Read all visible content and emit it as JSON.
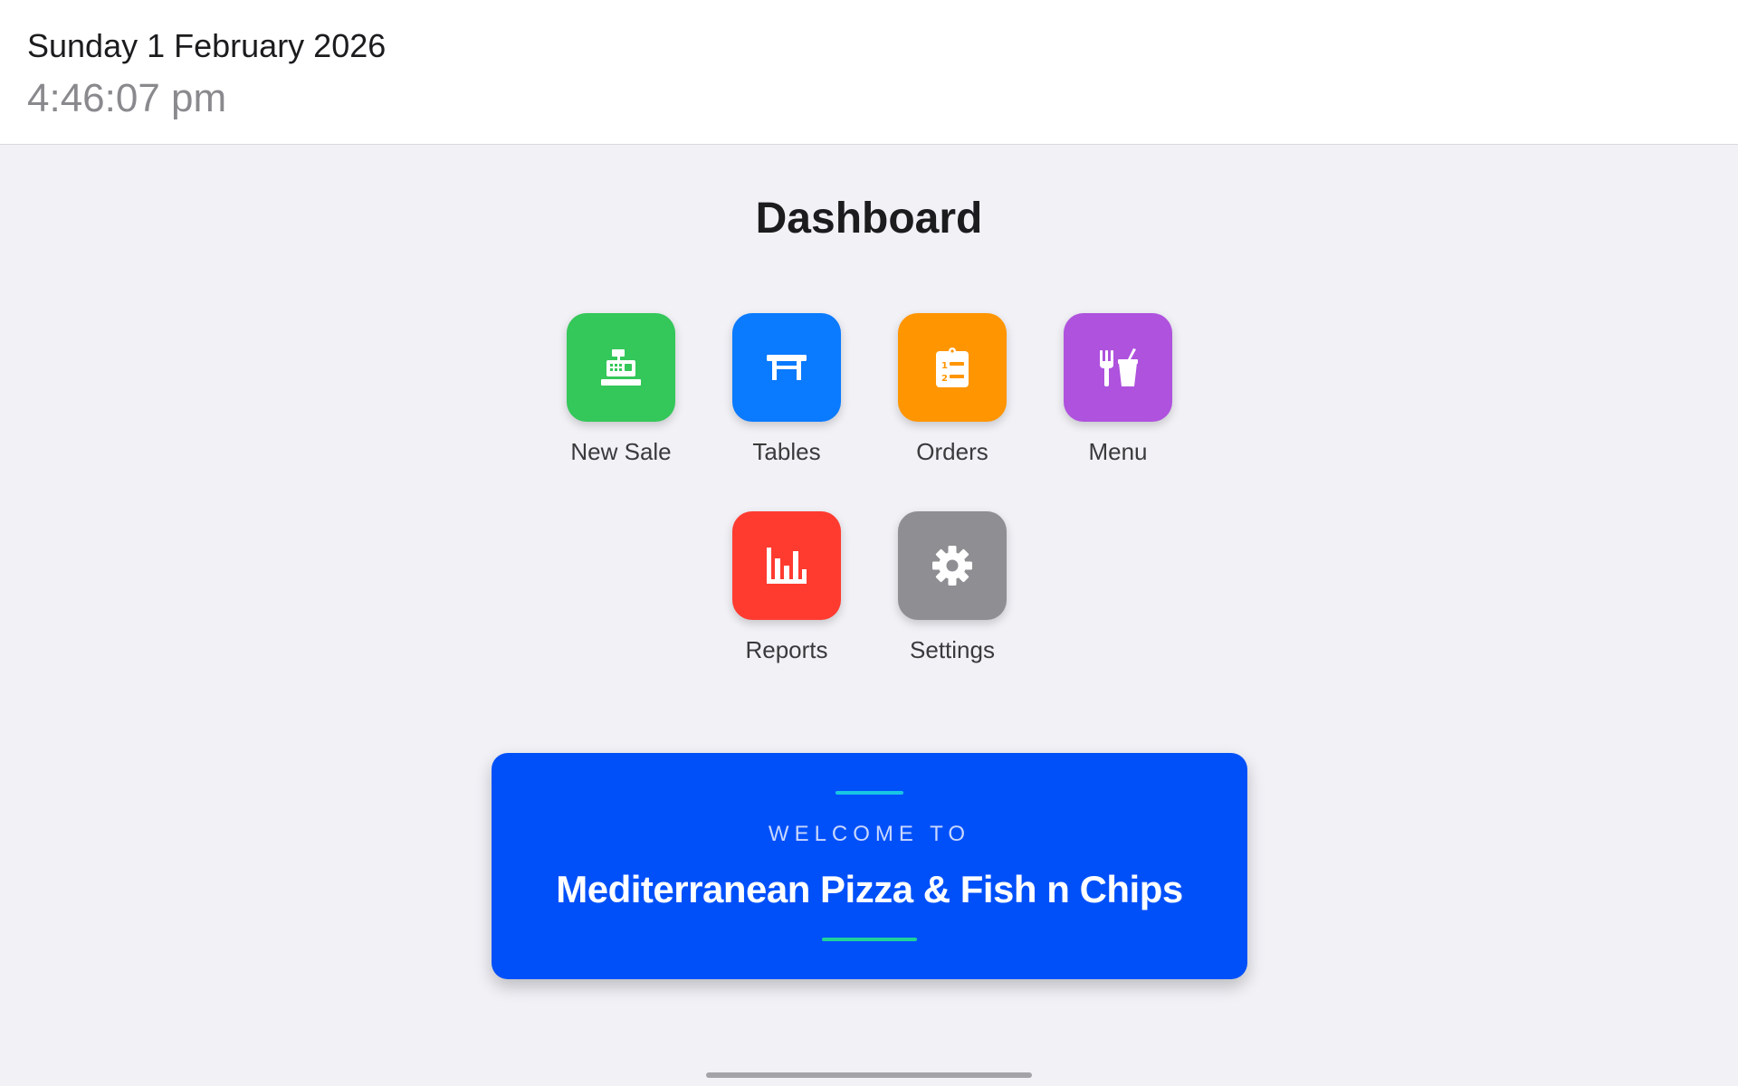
{
  "header": {
    "date": "Sunday 1 February 2026",
    "time": "4:46:07 pm"
  },
  "dashboard": {
    "title": "Dashboard",
    "tiles": [
      {
        "label": "New Sale",
        "icon": "cash-register-icon",
        "color": "#34c759"
      },
      {
        "label": "Tables",
        "icon": "table-icon",
        "color": "#0a7aff"
      },
      {
        "label": "Orders",
        "icon": "clipboard-list-icon",
        "color": "#ff9500"
      },
      {
        "label": "Menu",
        "icon": "utensils-drink-icon",
        "color": "#af52de"
      },
      {
        "label": "Reports",
        "icon": "bar-chart-icon",
        "color": "#ff3b30"
      },
      {
        "label": "Settings",
        "icon": "gear-icon",
        "color": "#8e8e93"
      }
    ]
  },
  "welcome": {
    "subtitle": "WELCOME TO",
    "name": "Mediterranean Pizza & Fish n Chips",
    "background": "#0050fa"
  }
}
